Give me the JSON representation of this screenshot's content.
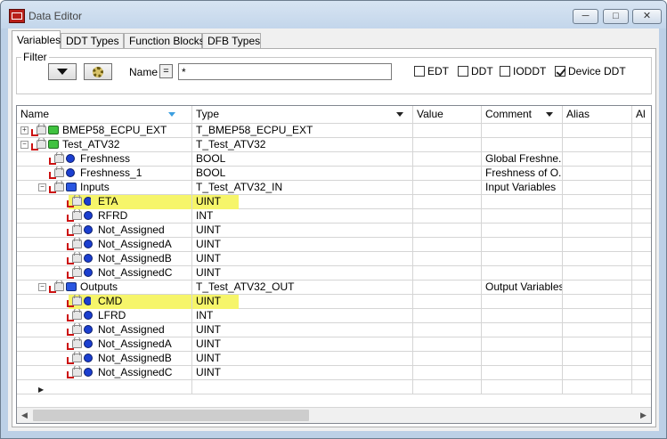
{
  "window": {
    "title": "Data Editor",
    "icon": "data-editor-app-icon",
    "min_icon": "minimize-icon",
    "max_icon": "maximize-icon",
    "close_icon": "close-icon"
  },
  "tabs": [
    "Variables",
    "DDT Types",
    "Function Blocks",
    "DFB Types"
  ],
  "filter": {
    "legend": "Filter",
    "filter_icon": "funnel-icon",
    "settings_icon": "gear-icon",
    "name_label": "Name",
    "equals_label": "=",
    "name_value": "*",
    "checkboxes": [
      {
        "label": "EDT",
        "checked": false
      },
      {
        "label": "DDT",
        "checked": false
      },
      {
        "label": "IODDT",
        "checked": false
      },
      {
        "label": "Device DDT",
        "checked": true
      }
    ]
  },
  "columns": [
    "Name",
    "Type",
    "Value",
    "Comment",
    "Alias",
    "Al"
  ],
  "rows": [
    {
      "name": "BMEP58_ECPU_EXT",
      "type": "T_BMEP58_ECPU_EXT",
      "comment": "",
      "icon": "green-structure-icon",
      "level": 0,
      "expander": "+",
      "highlight": false
    },
    {
      "name": "Test_ATV32",
      "type": "T_Test_ATV32",
      "comment": "",
      "icon": "green-structure-icon",
      "level": 0,
      "expander": "-",
      "highlight": false
    },
    {
      "name": "Freshness",
      "type": "BOOL",
      "comment": "Global Freshne...",
      "icon": "blue-variable-icon",
      "level": 1,
      "expander": "",
      "highlight": false
    },
    {
      "name": "Freshness_1",
      "type": "BOOL",
      "comment": "Freshness of O...",
      "icon": "blue-variable-icon",
      "level": 1,
      "expander": "",
      "highlight": false
    },
    {
      "name": "Inputs",
      "type": "T_Test_ATV32_IN",
      "comment": "Input Variables",
      "icon": "blue-structure-icon",
      "level": 1,
      "expander": "-",
      "highlight": false
    },
    {
      "name": "ETA",
      "type": "UINT",
      "comment": "",
      "icon": "blue-variable-icon",
      "level": 2,
      "expander": "",
      "highlight": true
    },
    {
      "name": "RFRD",
      "type": "INT",
      "comment": "",
      "icon": "blue-variable-icon",
      "level": 2,
      "expander": "",
      "highlight": false
    },
    {
      "name": "Not_Assigned",
      "type": "UINT",
      "comment": "",
      "icon": "blue-variable-icon",
      "level": 2,
      "expander": "",
      "highlight": false
    },
    {
      "name": "Not_AssignedA",
      "type": "UINT",
      "comment": "",
      "icon": "blue-variable-icon",
      "level": 2,
      "expander": "",
      "highlight": false
    },
    {
      "name": "Not_AssignedB",
      "type": "UINT",
      "comment": "",
      "icon": "blue-variable-icon",
      "level": 2,
      "expander": "",
      "highlight": false
    },
    {
      "name": "Not_AssignedC",
      "type": "UINT",
      "comment": "",
      "icon": "blue-variable-icon",
      "level": 2,
      "expander": "",
      "highlight": false
    },
    {
      "name": "Outputs",
      "type": "T_Test_ATV32_OUT",
      "comment": "Output Variables",
      "icon": "blue-structure-icon",
      "level": 1,
      "expander": "-",
      "highlight": false
    },
    {
      "name": "CMD",
      "type": "UINT",
      "comment": "",
      "icon": "blue-variable-icon",
      "level": 2,
      "expander": "",
      "highlight": true
    },
    {
      "name": "LFRD",
      "type": "INT",
      "comment": "",
      "icon": "blue-variable-icon",
      "level": 2,
      "expander": "",
      "highlight": false
    },
    {
      "name": "Not_Assigned",
      "type": "UINT",
      "comment": "",
      "icon": "blue-variable-icon",
      "level": 2,
      "expander": "",
      "highlight": false
    },
    {
      "name": "Not_AssignedA",
      "type": "UINT",
      "comment": "",
      "icon": "blue-variable-icon",
      "level": 2,
      "expander": "",
      "highlight": false
    },
    {
      "name": "Not_AssignedB",
      "type": "UINT",
      "comment": "",
      "icon": "blue-variable-icon",
      "level": 2,
      "expander": "",
      "highlight": false
    },
    {
      "name": "Not_AssignedC",
      "type": "UINT",
      "comment": "",
      "icon": "blue-variable-icon",
      "level": 2,
      "expander": "",
      "highlight": false
    }
  ],
  "new_row_icon": "new-row-arrow-icon",
  "scrollbar": {
    "left_icon": "scroll-left-icon",
    "right_icon": "scroll-right-icon"
  },
  "colors": {
    "highlight": "#f6f56a",
    "title_bar": "#c3d6eb",
    "variable_icon": "#1b3fd0",
    "structure_icon": "#3fc23f"
  }
}
